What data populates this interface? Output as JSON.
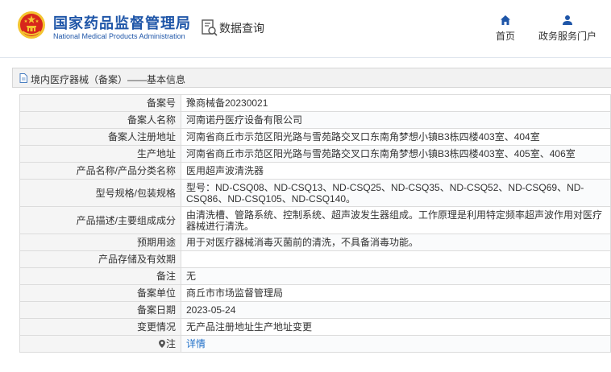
{
  "header": {
    "agency_cn": "国家药品监督管理局",
    "agency_en": "National Medical Products Administration",
    "page_title": "数据查询",
    "nav": [
      {
        "label": "首页",
        "icon": "home-icon"
      },
      {
        "label": "政务服务门户",
        "icon": "user-icon"
      }
    ]
  },
  "breadcrumb": {
    "text": "境内医疗器械（备案）——基本信息",
    "icon": "document-icon"
  },
  "record": {
    "labels": {
      "record_no": "备案号",
      "filer_name": "备案人名称",
      "registered_address": "备案人注册地址",
      "production_address": "生产地址",
      "product_name_category": "产品名称/产品分类名称",
      "model_spec": "型号规格/包装规格",
      "description": "产品描述/主要组成成分",
      "intended_use": "预期用途",
      "storage_validity": "产品存储及有效期",
      "remarks": "备注",
      "filing_unit": "备案单位",
      "filing_date": "备案日期",
      "change_status": "变更情况",
      "note": "注"
    },
    "values": {
      "record_no": "豫商械备20230021",
      "filer_name": "河南诺丹医疗设备有限公司",
      "registered_address": "河南省商丘市示范区阳光路与雪苑路交叉口东南角梦想小镇B3栋四楼403室、404室",
      "production_address": "河南省商丘市示范区阳光路与雪苑路交叉口东南角梦想小镇B3栋四楼403室、405室、406室",
      "product_name_category": "医用超声波清洗器",
      "model_spec": "型号：ND-CSQ08、ND-CSQ13、ND-CSQ25、ND-CSQ35、ND-CSQ52、ND-CSQ69、ND-CSQ86、ND-CSQ105、ND-CSQ140。",
      "description": "由清洗槽、管路系统、控制系统、超声波发生器组成。工作原理是利用特定频率超声波作用对医疗器械进行清洗。",
      "intended_use": "用于对医疗器械消毒灭菌前的清洗，不具备消毒功能。",
      "storage_validity": "",
      "remarks": "无",
      "filing_unit": "商丘市市场监督管理局",
      "filing_date": "2023-05-24",
      "change_status": "无产品注册地址生产地址变更",
      "note_link": "详情"
    }
  },
  "colors": {
    "brand_blue": "#1f56a8",
    "link_blue": "#1f6fc8",
    "emblem_red": "#d7261c",
    "emblem_gold": "#f4c430"
  }
}
